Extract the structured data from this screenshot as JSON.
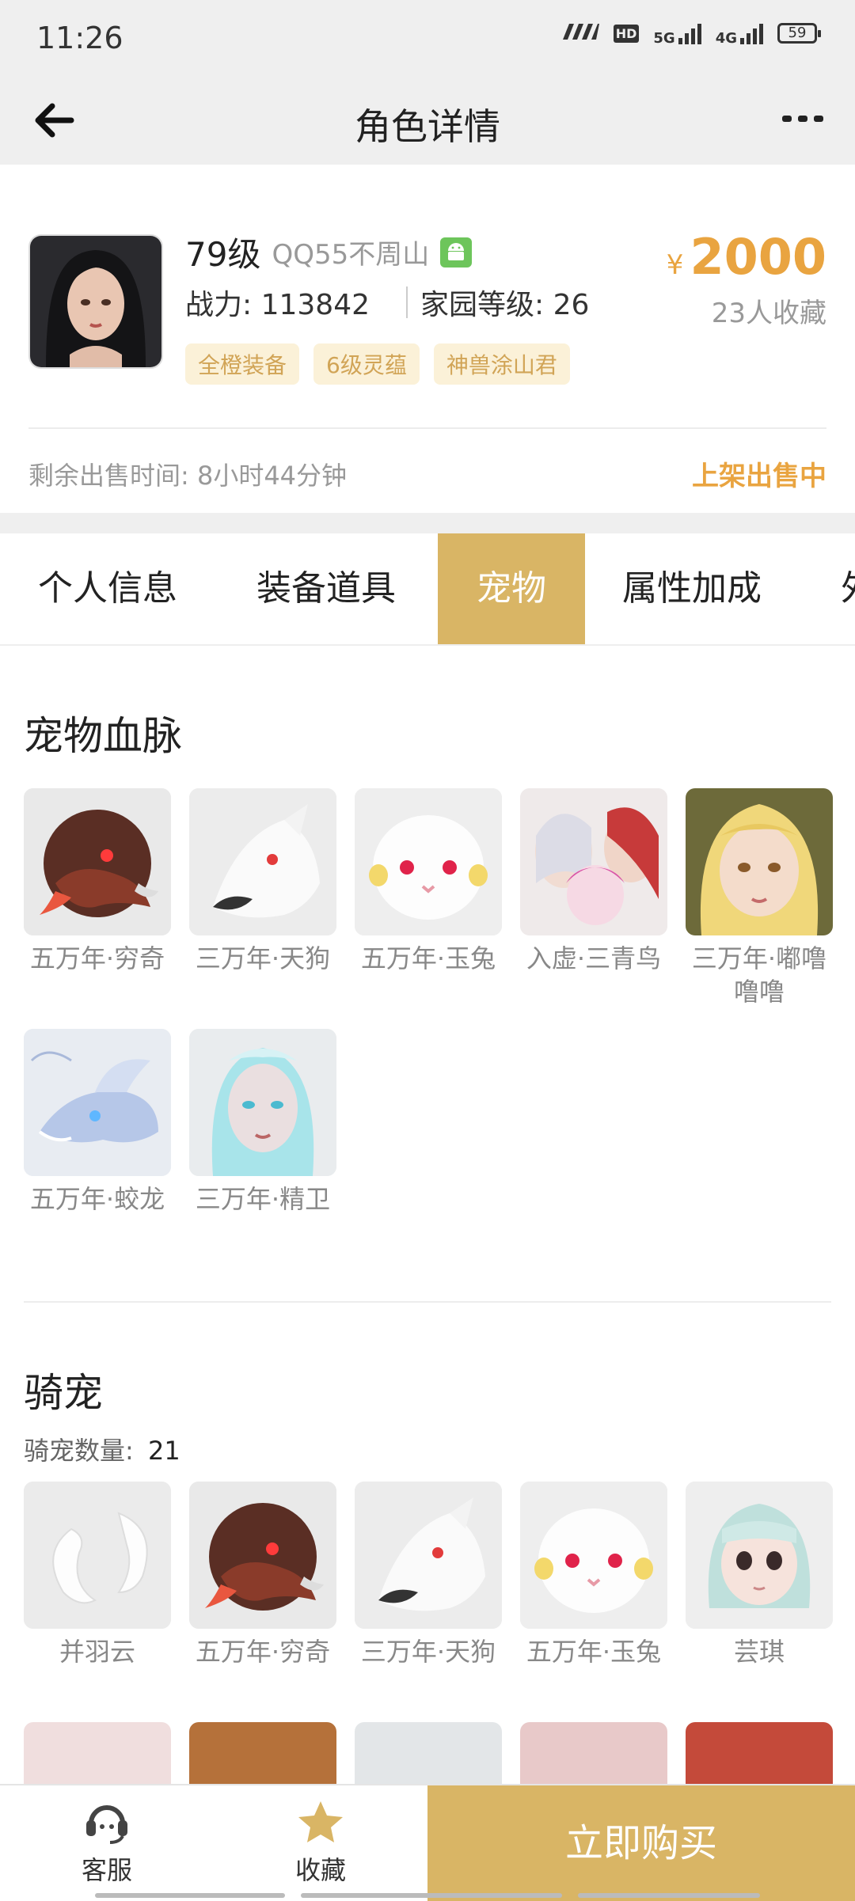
{
  "status_bar": {
    "time": "11:26",
    "network_5g": "5G",
    "network_4g": "4G",
    "hd": "HD",
    "battery": "59"
  },
  "nav": {
    "title": "角色详情"
  },
  "character": {
    "level": "79级",
    "server": "QQ55不周山",
    "combat_power": "战力: 113842",
    "home_level": "家园等级: 26",
    "tags": [
      "全橙装备",
      "6级灵蕴",
      "神兽涂山君"
    ],
    "price_symbol": "¥",
    "price": "2000",
    "favorites": "23人收藏",
    "remaining_time": "剩余出售时间: 8小时44分钟",
    "sale_status": "上架出售中"
  },
  "tabs": [
    "个人信息",
    "装备道具",
    "宠物",
    "属性加成",
    "外"
  ],
  "active_tab": "宠物",
  "pet_bloodline": {
    "title": "宠物血脉",
    "items": [
      {
        "name": "五万年·穷奇",
        "icon": "qiongqi-icon"
      },
      {
        "name": "三万年·天狗",
        "icon": "tiangou-icon"
      },
      {
        "name": "五万年·玉兔",
        "icon": "yutu-icon"
      },
      {
        "name": "入虚·三青鸟",
        "icon": "sanqingniao-icon"
      },
      {
        "name": "三万年·嘟噜噜噜",
        "icon": "dululu-icon"
      },
      {
        "name": "五万年·蛟龙",
        "icon": "jiaolong-icon"
      },
      {
        "name": "三万年·精卫",
        "icon": "jingwei-icon"
      }
    ]
  },
  "mounts": {
    "title": "骑宠",
    "count_label": "骑宠数量:",
    "count": "21",
    "items": [
      {
        "name": "并羽云",
        "icon": "bingyuyun-icon"
      },
      {
        "name": "五万年·穷奇",
        "icon": "qiongqi-icon"
      },
      {
        "name": "三万年·天狗",
        "icon": "tiangou-icon"
      },
      {
        "name": "五万年·玉兔",
        "icon": "yutu-icon"
      },
      {
        "name": "芸琪",
        "icon": "yunqi-icon"
      }
    ]
  },
  "bottom_bar": {
    "service": "客服",
    "favorite": "收藏",
    "buy": "立即购买"
  },
  "colors": {
    "accent": "#d9b565",
    "price": "#e9a440",
    "tag_bg": "#fbf1d8",
    "tag_text": "#d1a456"
  }
}
